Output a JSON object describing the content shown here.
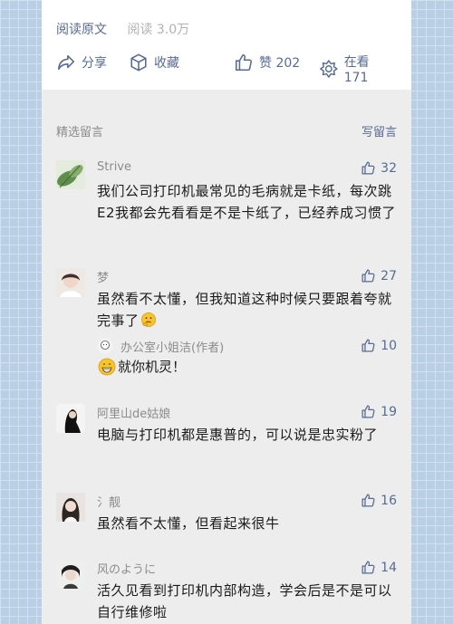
{
  "article_footer": {
    "read_original": "阅读原文",
    "read_count": "阅读 3.0万",
    "share_label": "分享",
    "favorite_label": "收藏",
    "like_label": "赞 202",
    "watching_label": "在看 171"
  },
  "comments_section": {
    "title": "精选留言",
    "write_label": "写留言"
  },
  "comments": [
    {
      "nickname": "Strive",
      "likes": "32",
      "text": "我们公司打印机最常见的毛病就是卡纸，每次跳E2我都会先看看是不是卡纸了，已经养成习惯了"
    },
    {
      "nickname": "梦",
      "likes": "27",
      "text": "虽然看不太懂，但我知道这种时候只要跟着夸就完事了"
    },
    {
      "nickname": "阿里山de姑娘",
      "likes": "19",
      "text": "电脑与打印机都是惠普的，可以说是忠实粉了"
    },
    {
      "nickname": "氵靓",
      "likes": "16",
      "text": "虽然看不太懂，但看起来很牛"
    },
    {
      "nickname": "风のように",
      "likes": "14",
      "text": "活久见看到打印机内部构造，学会后是不是可以自行维修啦"
    }
  ],
  "author_reply": {
    "nickname": "办公室小姐洁(作者)",
    "likes": "10",
    "text": "就你机灵！"
  },
  "colors": {
    "link_blue": "#576b95",
    "page_bg": "#ededed",
    "outer_grid": "#b9cfe3"
  }
}
